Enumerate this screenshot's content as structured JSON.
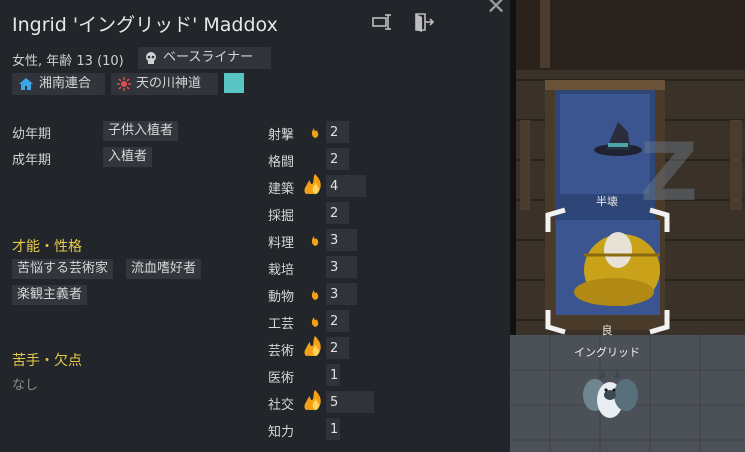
{
  "pawn": {
    "name": "Ingrid 'イングリッド' Maddox",
    "gender_age": "女性, 年齢 13 (10)",
    "xenotype": "ベースライナー",
    "faction": "湘南連合",
    "ideology": "天の川神道",
    "favorite_color": "#58c4c4"
  },
  "backstory": [
    {
      "label": "幼年期",
      "value": "子供入植者"
    },
    {
      "label": "成年期",
      "value": "入植者"
    }
  ],
  "traits_header": "才能・性格",
  "traits": [
    "苦悩する芸術家",
    "流血嗜好者",
    "楽観主義者"
  ],
  "incapable_header": "苦手・欠点",
  "incapable_value": "なし",
  "skills": [
    {
      "name": "射撃",
      "level": 2,
      "passion": "minor"
    },
    {
      "name": "格闘",
      "level": 2,
      "passion": "none"
    },
    {
      "name": "建築",
      "level": 4,
      "passion": "major"
    },
    {
      "name": "採掘",
      "level": 2,
      "passion": "none"
    },
    {
      "name": "料理",
      "level": 3,
      "passion": "minor"
    },
    {
      "name": "栽培",
      "level": 3,
      "passion": "none"
    },
    {
      "name": "動物",
      "level": 3,
      "passion": "minor"
    },
    {
      "name": "工芸",
      "level": 2,
      "passion": "minor"
    },
    {
      "name": "芸術",
      "level": 2,
      "passion": "major"
    },
    {
      "name": "医術",
      "level": 1,
      "passion": "none"
    },
    {
      "name": "社交",
      "level": 5,
      "passion": "major"
    },
    {
      "name": "知力",
      "level": 1,
      "passion": "none"
    }
  ],
  "header_icons": [
    "rename-icon",
    "banish-icon",
    "close-icon"
  ],
  "world": {
    "bed_label": "半壊",
    "selected_label": "良",
    "pawn_label": "イングリッド",
    "sleep_glyph": "Z"
  }
}
